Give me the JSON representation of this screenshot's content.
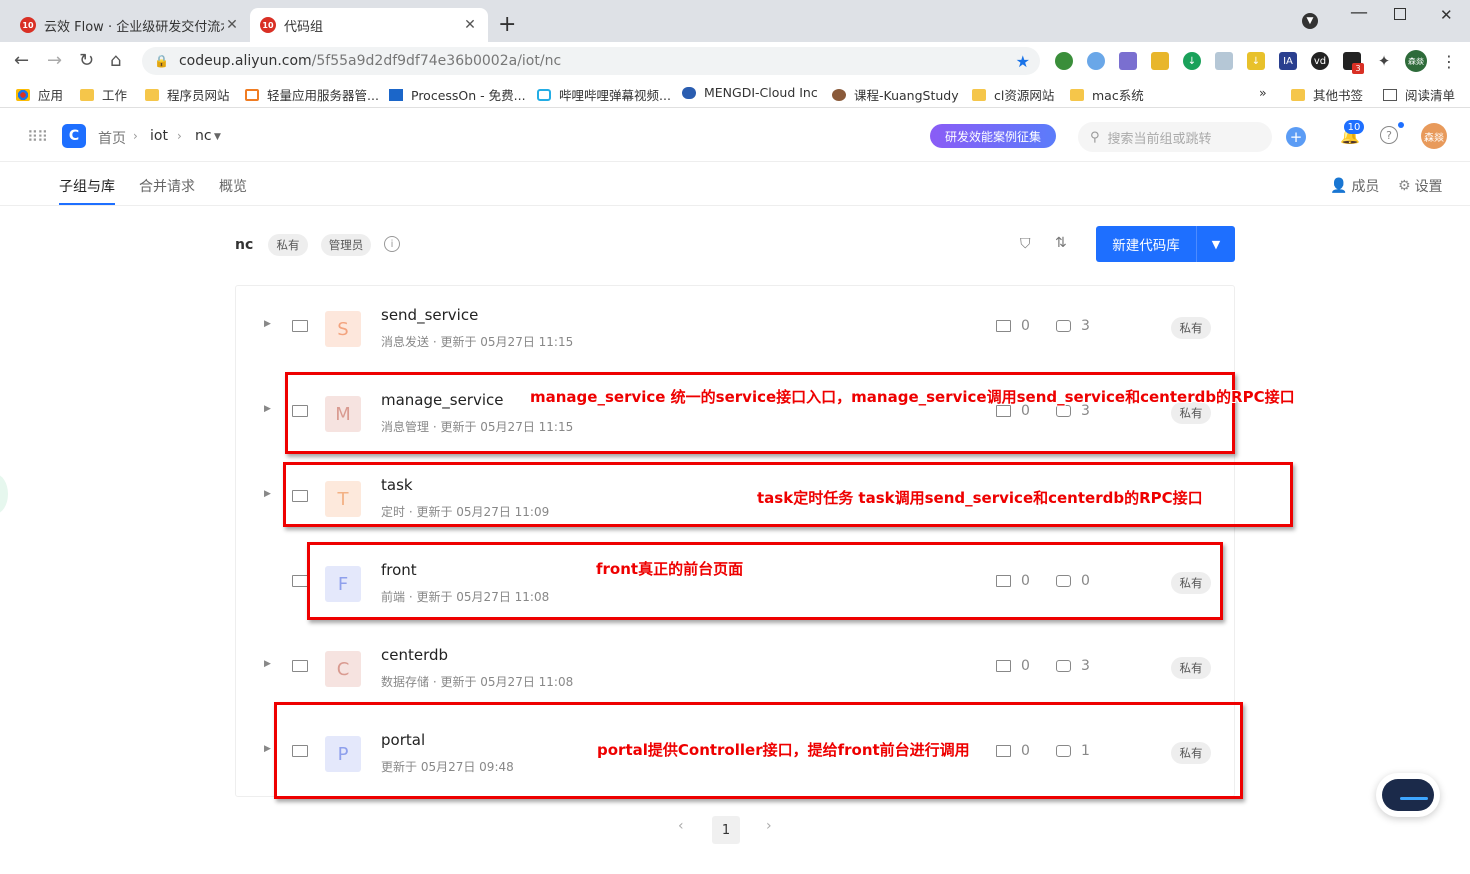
{
  "browser": {
    "tabs": [
      {
        "title": "云效 Flow · 企业级研发交付流水",
        "icon": "yunxiao-favicon"
      },
      {
        "title": "代码组",
        "icon": "yunxiao-favicon"
      }
    ],
    "url_host": "codeup.aliyun.com",
    "url_path": "/5f55a9d2df9df74e36b0002a/iot/nc",
    "bookmarks": [
      "应用",
      "工作",
      "程序员网站",
      "轻量应用服务器管...",
      "ProcessOn - 免费...",
      "哔哩哔哩弹幕视频...",
      "MENGDI-Cloud Inc",
      "课程-KuangStudy",
      "cl资源网站",
      "mac系统"
    ],
    "bookmarks_right": [
      "其他书签",
      "阅读清单"
    ],
    "more_label": "»",
    "ext_badge": "3",
    "profile_label": "森燚"
  },
  "header": {
    "breadcrumb": [
      "首页",
      "iot",
      "nc"
    ],
    "promo_label": "研发效能案例征集",
    "search_placeholder": "搜索当前组或跳转",
    "notify_count": "10",
    "avatar_label": "森燚"
  },
  "subnav": {
    "tabs": [
      "子组与库",
      "合并请求",
      "概览"
    ],
    "members_label": "成员",
    "settings_label": "设置"
  },
  "group": {
    "name": "nc",
    "tags": [
      "私有",
      "管理员"
    ],
    "new_button": "新建代码库"
  },
  "repos": [
    {
      "letter": "S",
      "name": "send_service",
      "desc": "消息发送",
      "updated": "更新于 05月27日 11:15",
      "folders": "0",
      "repos": "3",
      "visibility": "私有",
      "bg": "#fde7dc",
      "fg": "#f3a37e"
    },
    {
      "letter": "M",
      "name": "manage_service",
      "desc": "消息管理",
      "updated": "更新于 05月27日 11:15",
      "folders": "0",
      "repos": "3",
      "visibility": "私有",
      "bg": "#f6e3e0",
      "fg": "#d99a90"
    },
    {
      "letter": "T",
      "name": "task",
      "desc": "定时",
      "updated": "更新于 05月27日 11:09",
      "folders": "",
      "repos": "",
      "visibility": "",
      "bg": "#fde9dc",
      "fg": "#f3b184"
    },
    {
      "letter": "F",
      "name": "front",
      "desc": "前端",
      "updated": "更新于 05月27日 11:08",
      "folders": "0",
      "repos": "0",
      "visibility": "私有",
      "bg": "#e4e8fb",
      "fg": "#8fa0ec"
    },
    {
      "letter": "C",
      "name": "centerdb",
      "desc": "数据存储",
      "updated": "更新于 05月27日 11:08",
      "folders": "0",
      "repos": "3",
      "visibility": "私有",
      "bg": "#f6e3e0",
      "fg": "#d99a90"
    },
    {
      "letter": "P",
      "name": "portal",
      "desc": "",
      "updated": "更新于 05月27日 09:48",
      "folders": "0",
      "repos": "1",
      "visibility": "私有",
      "bg": "#e4e8fb",
      "fg": "#8fa0ec"
    }
  ],
  "annotations": [
    "manage_service 统一的service接口入口，manage_service调用send_service和centerdb的RPC接口",
    "task定时任务 task调用send_service和centerdb的RPC接口",
    "front真正的前台页面",
    "portal提供Controller接口，提给front前台进行调用"
  ],
  "pagination": {
    "current": "1"
  },
  "colors": {
    "accent": "#1e6fff",
    "annotation": "#ee0000"
  }
}
